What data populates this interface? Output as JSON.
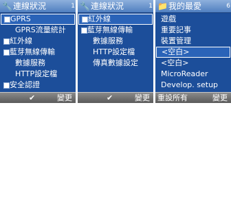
{
  "screens": [
    {
      "title": "連線狀況",
      "page": "1",
      "icon": "wrench-icon",
      "items": [
        {
          "label": "GPRS",
          "checkbox": true
        },
        {
          "label": "GPRS流量統計",
          "checkbox": false
        },
        {
          "label": "紅外線",
          "checkbox": true
        },
        {
          "label": "藍芽無線傳輸",
          "checkbox": true
        },
        {
          "label": "數據服務",
          "checkbox": false
        },
        {
          "label": "HTTP設定檔",
          "checkbox": false
        },
        {
          "label": "安全認證",
          "checkbox": true
        }
      ],
      "selected_index": 0,
      "softkeys": {
        "left": "",
        "center": "✔",
        "right": "變更"
      }
    },
    {
      "title": "連線狀況",
      "page": "1",
      "icon": "wrench-icon",
      "items": [
        {
          "label": "紅外線",
          "checkbox": true
        },
        {
          "label": "藍芽無線傳輸",
          "checkbox": true
        },
        {
          "label": "數據服務",
          "checkbox": false
        },
        {
          "label": "HTTP設定檔",
          "checkbox": false
        },
        {
          "label": "傳真數據設定",
          "checkbox": false
        }
      ],
      "selected_index": 0,
      "softkeys": {
        "left": "",
        "center": "✔",
        "right": "變更"
      }
    },
    {
      "title": "我的最愛",
      "page": "6",
      "icon": "folder-icon",
      "items": [
        {
          "label": "遊戲"
        },
        {
          "label": "重要記事"
        },
        {
          "label": "裝置管理"
        },
        {
          "label": "<空白>"
        },
        {
          "label": "<空白>"
        },
        {
          "label": "MicroReader"
        },
        {
          "label": "Develop. setup"
        }
      ],
      "selected_index": 3,
      "softkeys": {
        "left": "重設所有",
        "center": "",
        "right": "變更"
      }
    }
  ]
}
